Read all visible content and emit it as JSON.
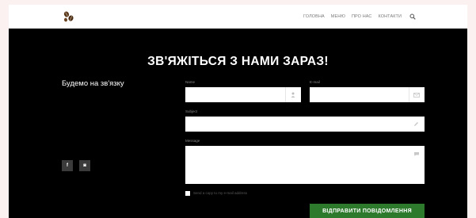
{
  "header": {
    "logo_icon": "coffee-beans-icon",
    "nav": [
      {
        "label": "ГОЛОВНА"
      },
      {
        "label": "МЕНЮ"
      },
      {
        "label": "ПРО НАС"
      },
      {
        "label": "КОНТАКТИ"
      }
    ],
    "search_icon": "search-icon"
  },
  "contact": {
    "title": "ЗВ'ЯЖІТЬСЯ З НАМИ ЗАРАЗ!",
    "subtitle": "Будемо на зв'язку",
    "social": [
      {
        "icon": "facebook-icon",
        "glyph": "f"
      },
      {
        "icon": "instagram-icon",
        "glyph": "◙"
      }
    ],
    "form": {
      "name_label": "Name",
      "email_label": "E-mail",
      "subject_label": "Subject",
      "message_label": "Message",
      "name_value": "",
      "email_value": "",
      "subject_value": "",
      "message_value": "",
      "copy_label": "Send a copy to my e-mail address",
      "submit_label": "ВІДПРАВИТИ ПОВІДОМЛЕННЯ"
    }
  },
  "colors": {
    "page_background": "#fbf1f1",
    "main_background": "#000000",
    "submit_button": "#2d7a2d",
    "nav_text": "#7a7a7a"
  }
}
